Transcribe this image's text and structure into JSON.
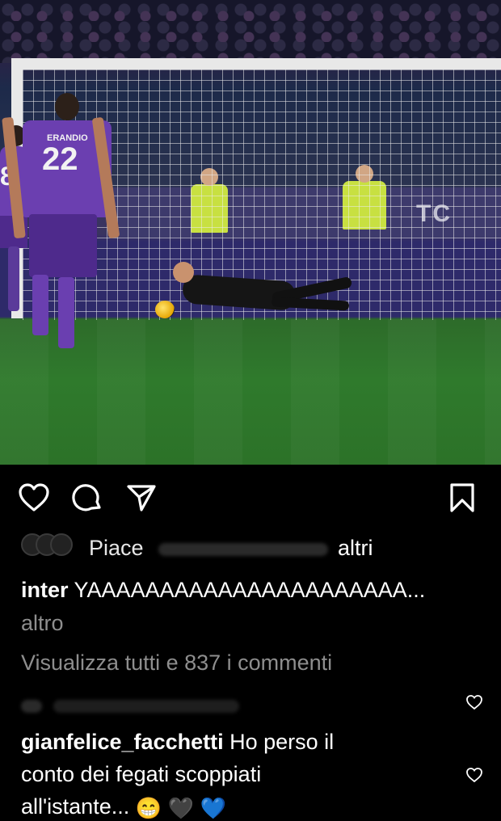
{
  "photo": {
    "ad_text": "TC",
    "jersey_number": "22",
    "jersey_name": "ERANDIO",
    "left_number": "8"
  },
  "actions": {
    "like_icon": "heart-outline-icon",
    "comment_icon": "comment-bubble-icon",
    "share_icon": "paper-plane-icon",
    "save_icon": "bookmark-icon"
  },
  "likes": {
    "prefix": "Piace",
    "suffix": "altri"
  },
  "caption": {
    "username": "inter",
    "text": "YAAAAAAAAAAAAAAAAAAAAAA...",
    "more": "altro"
  },
  "comments_link": "Visualizza tutti e 837 i commenti",
  "comments": [
    {
      "username": "gianfelice_facchetti",
      "text_line1": "Ho perso il",
      "text_line2": "conto dei fegati scoppiati",
      "text_line3": "all'istante...",
      "emojis": [
        "😁",
        "🖤",
        "💙"
      ]
    }
  ],
  "colors": {
    "background": "#000000",
    "text": "#ffffff",
    "secondary_text": "#8e8e8e",
    "fiorentina_purple": "#6b3fb0"
  }
}
